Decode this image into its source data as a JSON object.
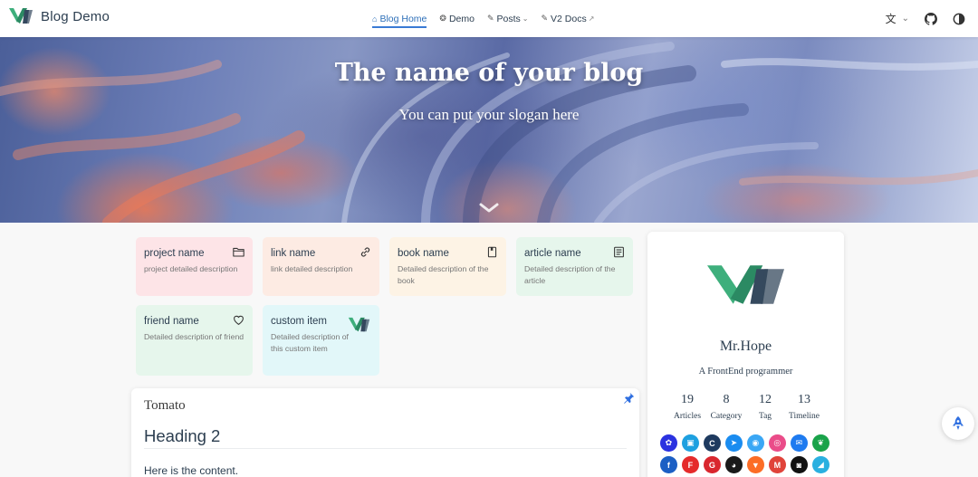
{
  "navbar": {
    "brand_title": "Blog Demo",
    "links": [
      {
        "label": "Blog Home",
        "icon": "home-icon",
        "active": true
      },
      {
        "label": "Demo",
        "icon": "discover-icon",
        "dropdown": false
      },
      {
        "label": "Posts",
        "icon": "edit-icon",
        "dropdown": true
      },
      {
        "label": "V2 Docs",
        "icon": "note-icon",
        "external": true
      }
    ],
    "right": [
      "language-icon",
      "github-icon",
      "theme-toggle-icon"
    ]
  },
  "hero": {
    "title": "The name of your blog",
    "slogan": "You can put your slogan here"
  },
  "projects": [
    {
      "name": "project name",
      "desc": "project detailed description",
      "icon": "folder-icon",
      "color": "#fde4e7"
    },
    {
      "name": "link name",
      "desc": "link detailed description",
      "icon": "link-icon",
      "color": "#fdebe3"
    },
    {
      "name": "book name",
      "desc": "Detailed description of the book",
      "icon": "book-icon",
      "color": "#fdf3e5"
    },
    {
      "name": "article name",
      "desc": "Detailed description of the article",
      "icon": "article-icon",
      "color": "#e6f6ec"
    },
    {
      "name": "friend name",
      "desc": "Detailed description of friend",
      "icon": "heart-icon",
      "color": "#e6f6ec"
    },
    {
      "name": "custom item",
      "desc": "Detailed description of this custom item",
      "icon": "logo-icon",
      "color": "#e2f7f9"
    }
  ],
  "article": {
    "title": "Tomato",
    "heading": "Heading 2",
    "content": "Here is the content."
  },
  "blogger": {
    "name": "Mr.Hope",
    "description": "A FrontEnd programmer",
    "stats": [
      {
        "num": "19",
        "label": "Articles"
      },
      {
        "num": "8",
        "label": "Category"
      },
      {
        "num": "12",
        "label": "Tag"
      },
      {
        "num": "13",
        "label": "Timeline"
      }
    ],
    "socials_row1": [
      {
        "name": "baidu-icon",
        "color": "#2b32e0"
      },
      {
        "name": "bilibili-icon",
        "color": "#1ea0e0"
      },
      {
        "name": "csdn-icon",
        "color": "#1e3a5f"
      },
      {
        "name": "dingding-icon",
        "color": "#1a8cf0"
      },
      {
        "name": "discord-icon",
        "color": "#3aa7f5"
      },
      {
        "name": "dribbble-icon",
        "color": "#ea4c89"
      },
      {
        "name": "email-icon",
        "color": "#1e7bf0"
      },
      {
        "name": "evernote-icon",
        "color": "#1aa34a"
      }
    ],
    "socials_row2": [
      {
        "name": "facebook-icon",
        "color": "#1c5fc4"
      },
      {
        "name": "flipboard-icon",
        "color": "#e52b2b"
      },
      {
        "name": "gitee-icon",
        "color": "#d9272e"
      },
      {
        "name": "github-icon",
        "color": "#1a1a1a"
      },
      {
        "name": "gitlab-icon",
        "color": "#fc6d26"
      },
      {
        "name": "gmail-icon",
        "color": "#e0433a"
      },
      {
        "name": "instagram-icon",
        "color": "#111111"
      },
      {
        "name": "lark-icon",
        "color": "#2ab0e0"
      }
    ]
  },
  "back_to_top_icon": "rocket-icon"
}
